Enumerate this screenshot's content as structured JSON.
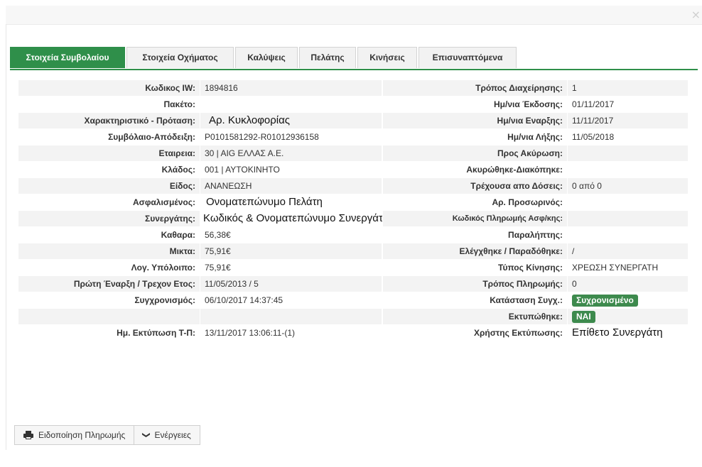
{
  "window": {
    "close_symbol": "×"
  },
  "tabs": [
    {
      "label": "Στοιχεία Συμβολαίου",
      "active": true
    },
    {
      "label": "Στοιχεία Οχήματος",
      "active": false
    },
    {
      "label": "Καλύψεις",
      "active": false
    },
    {
      "label": "Πελάτης",
      "active": false
    },
    {
      "label": "Κινήσεις",
      "active": false
    },
    {
      "label": "Επισυναπτόμενα",
      "active": false
    }
  ],
  "rows": [
    {
      "l1": "Κωδικος IW:",
      "v1": "1894816",
      "l2": "Τρόπος Διαχείρησης:",
      "v2": "1"
    },
    {
      "l1": "Πακέτο:",
      "v1": "",
      "l2": "Ημ/νια Έκδοσης:",
      "v2": "01/11/2017"
    },
    {
      "l1": "Χαρακτηριστικό - Πρόταση:",
      "v1": "Αρ. Κυκλοφορίας",
      "l2": "Ημ/νια Εναρξης:",
      "v2": "11/11/2017"
    },
    {
      "l1": "Συμβόλαιο-Απόδειξη:",
      "v1": "P0101581292-R01012936158",
      "l2": "Ημ/νια Λήξης:",
      "v2": "11/05/2018"
    },
    {
      "l1": "Εταιρεια:",
      "v1": "30 | AIG ΕΛΛΑΣ Α.Ε.",
      "l2": "Προς Ακύρωση:",
      "v2": ""
    },
    {
      "l1": "Κλάδος:",
      "v1": "001 | ΑΥΤΟΚΙΝΗΤΟ",
      "l2": "Ακυρώθηκε-Διακόπηκε:",
      "v2": ""
    },
    {
      "l1": "Είδος:",
      "v1": "ΑΝΑΝΕΩΣΗ",
      "l2": "Τρέχουσα απο Δόσεις:",
      "v2": "0 από 0"
    },
    {
      "l1": "Ασφαλισμένος:",
      "v1": "Ονοματεπώνυμο Πελάτη",
      "l2": "Αρ. Προσωρινός:",
      "v2": ""
    },
    {
      "l1": "Συνεργάτης:",
      "v1": "Κωδικός & Ονοματεπώνυμο Συνεργάτη",
      "l2": "Κωδικός Πληρωμής Ασφ/κης:",
      "v2": ""
    },
    {
      "l1": "Καθαρα:",
      "v1": "56,38€",
      "l2": "Παραλήπτης:",
      "v2": ""
    },
    {
      "l1": "Μικτα:",
      "v1": "75,91€",
      "l2": "Ελέγχθηκε / Παραδόθηκε:",
      "v2": "/"
    },
    {
      "l1": "Λογ. Υπόλοιπο:",
      "v1": "75,91€",
      "l2": "Τύπος Κίνησης:",
      "v2": "ΧΡΕΩΣΗ ΣΥΝΕΡΓΑΤΗ"
    },
    {
      "l1": "Πρώτη Έναρξη / Τρεχον Ετος:",
      "v1": "11/05/2013 / 5",
      "l2": "Τρόπος Πληρωμής:",
      "v2": "0"
    },
    {
      "l1": "Συγχρονισμός:",
      "v1": "06/10/2017 14:37:45",
      "l2": "Κατάσταση Συγχ.:",
      "v2": "Συχρονισμένο"
    },
    {
      "l1": "",
      "v1": "",
      "l2": "Εκτυπώθηκε:",
      "v2": "ΝΑΙ"
    },
    {
      "l1": "Ημ. Εκτύπωση Τ-Π:",
      "v1": "13/11/2017 13:06:11-(1)",
      "l2": "Χρήστης Εκτύπωσης:",
      "v2": "Επίθετο Συνεργάτη"
    }
  ],
  "buttons": {
    "payment_notice": "Ειδοποίηση Πληρωμής",
    "actions": "Ενέργειες"
  },
  "colors": {
    "accent": "#2f8f4a",
    "badge": "#3d8a4d"
  }
}
